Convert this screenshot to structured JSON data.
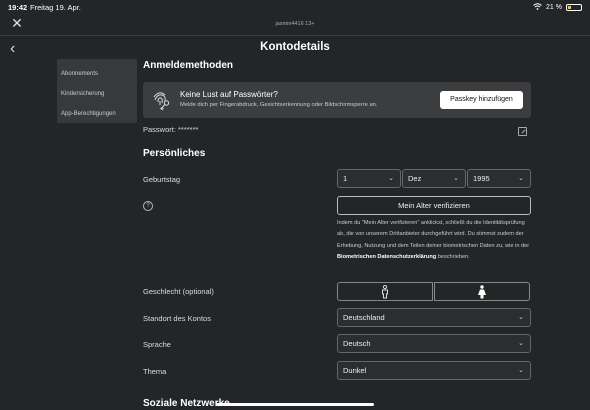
{
  "status_bar": {
    "time": "19:42",
    "date": "Freitag 19. Apr.",
    "url": "jasmin4416 13+",
    "battery": "21 %"
  },
  "header": {
    "title": "Kontodetails"
  },
  "sidebar": {
    "items": [
      {
        "label": "Abonnements"
      },
      {
        "label": "Kindersicherung"
      },
      {
        "label": "App-Berechtigungen"
      }
    ]
  },
  "login_methods": {
    "heading": "Anmeldemethoden",
    "passkey_title": "Keine Lust auf Passwörter?",
    "passkey_subtitle": "Melde dich per Fingerabdruck, Gesichtserkennung oder Bildschirmsperre an.",
    "passkey_button": "Passkey hinzufügen",
    "password_label": "Passwort: *******"
  },
  "personal": {
    "heading": "Persönliches",
    "birthday_label": "Geburtstag",
    "birthday_day": "1",
    "birthday_month": "Dez",
    "birthday_year": "1995",
    "verify_button": "Mein Alter verifizieren",
    "disclaimer_text": "Indem du \"Mein Alter verifizieren\" anklickst, schließt du die Identitätsprüfung ab, die von unserem Drittanbieter durchgeführt wird. Du stimmst zudem der Erhebung, Nutzung und dem Teilen deiner biometrischen Daten zu, wie in der ",
    "disclaimer_link": "Biometrischen Datenschutzerklärung",
    "disclaimer_end": " beschrieben.",
    "gender_label": "Geschlecht (optional)",
    "location_label": "Standort des Kontos",
    "location_value": "Deutschland",
    "language_label": "Sprache",
    "language_value": "Deutsch",
    "theme_label": "Thema",
    "theme_value": "Dunkel"
  },
  "social": {
    "heading": "Soziale Netzwerke"
  }
}
